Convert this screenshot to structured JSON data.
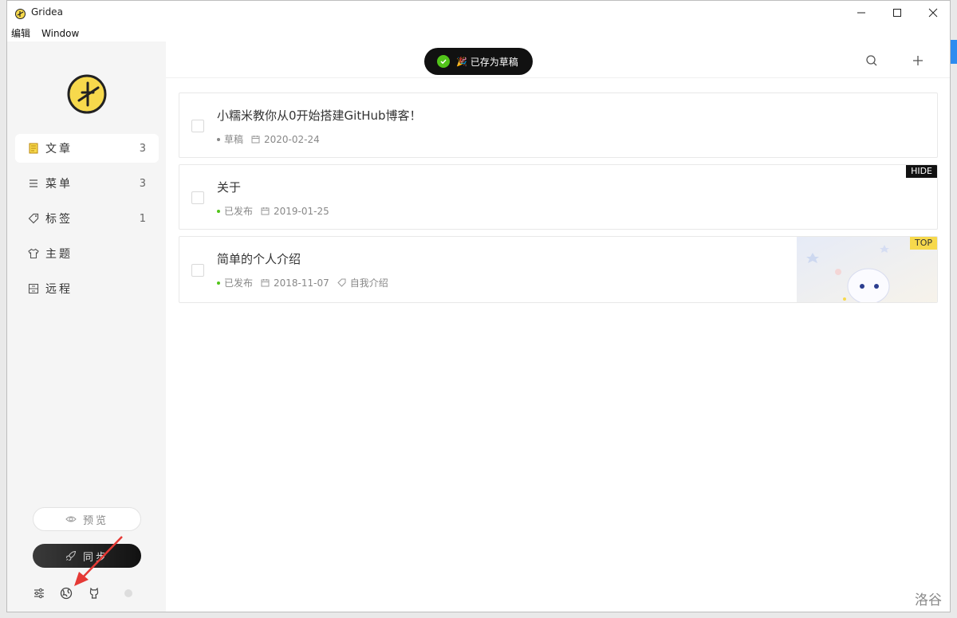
{
  "window": {
    "title": "Gridea"
  },
  "menu": [
    {
      "label": "编辑"
    },
    {
      "label": "Window"
    }
  ],
  "sidebar": {
    "items": [
      {
        "label": "文章",
        "count": "3",
        "icon": "article-icon"
      },
      {
        "label": "菜单",
        "count": "3",
        "icon": "menu-icon"
      },
      {
        "label": "标签",
        "count": "1",
        "icon": "tag-icon"
      },
      {
        "label": "主题",
        "icon": "theme-shirt-icon"
      },
      {
        "label": "远程",
        "icon": "remote-icon"
      }
    ],
    "preview_label": "预览",
    "sync_label": "同步"
  },
  "toast": {
    "text": "已存为草稿"
  },
  "posts": [
    {
      "title": "小糯米教你从0开始搭建GitHub博客！",
      "status": "草稿",
      "date": "2020-02-24",
      "status_color": "#888888"
    },
    {
      "title": "关于",
      "status": "已发布",
      "date": "2019-01-25",
      "badge": "HIDE",
      "status_color": "#52c41a"
    },
    {
      "title": "简单的个人介绍",
      "status": "已发布",
      "date": "2018-11-07",
      "tag": "自我介绍",
      "badge": "TOP",
      "status_color": "#52c41a"
    }
  ],
  "watermark": "洛谷",
  "colors": {
    "accent": "#f7d94c",
    "published": "#52c41a",
    "annotation": "#e53935"
  }
}
